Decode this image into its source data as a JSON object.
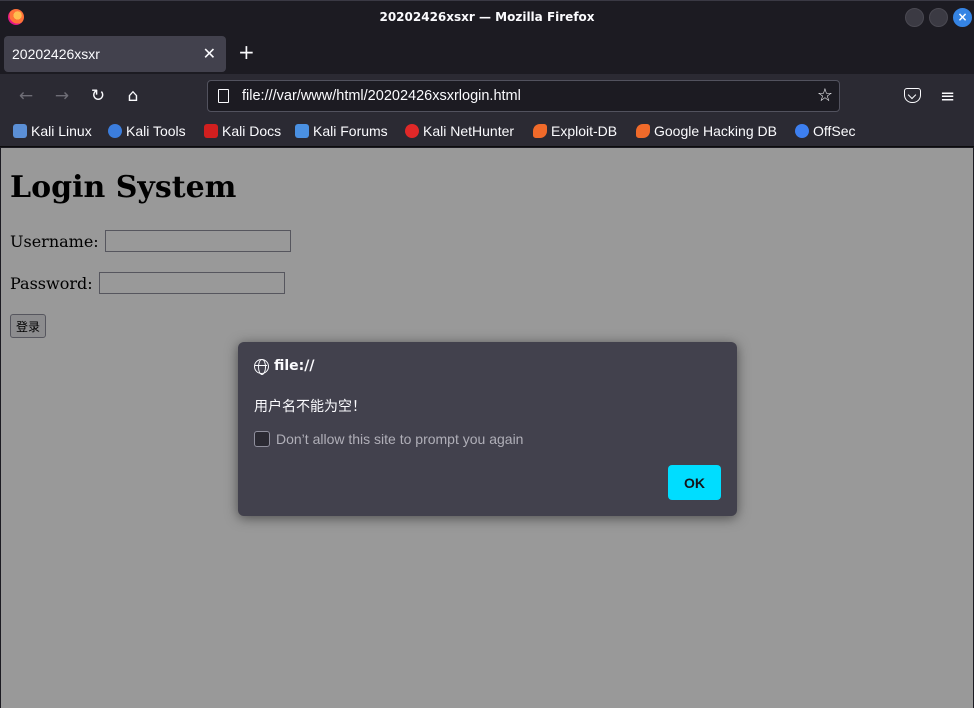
{
  "window": {
    "title": "20202426xsxr — Mozilla Firefox",
    "close_glyph": "×"
  },
  "tab": {
    "title": "20202426xsxr",
    "close_glyph": "✕",
    "newtab_glyph": "+"
  },
  "nav": {
    "back_glyph": "←",
    "forward_glyph": "→",
    "reload_glyph": "↻",
    "home_glyph": "⌂",
    "url": "file:///var/www/html/20202426xsxrlogin.html",
    "star_glyph": "☆",
    "menu_glyph": "≡"
  },
  "bookmarks": [
    {
      "label": "Kali Linux",
      "icon": "kali-dragon-icon",
      "color": "#5b8fd6"
    },
    {
      "label": "Kali Tools",
      "icon": "kali-tools-icon",
      "color": "#3b7ddd"
    },
    {
      "label": "Kali Docs",
      "icon": "kali-docs-icon",
      "color": "#d11f1f"
    },
    {
      "label": "Kali Forums",
      "icon": "kali-forums-icon",
      "color": "#4a90e2"
    },
    {
      "label": "Kali NetHunter",
      "icon": "kali-nethunter-icon",
      "color": "#e02828"
    },
    {
      "label": "Exploit-DB",
      "icon": "exploit-db-icon",
      "color": "#f06a2a"
    },
    {
      "label": "Google Hacking DB",
      "icon": "ghdb-icon",
      "color": "#f06a2a"
    },
    {
      "label": "OffSec",
      "icon": "offsec-icon",
      "color": "#3d7ff0"
    }
  ],
  "page": {
    "heading": "Login System",
    "username_label": "Username:",
    "password_label": "Password:",
    "submit_label": "登录"
  },
  "dialog": {
    "origin": "file://",
    "message": "用户名不能为空！",
    "checkbox_label": "Don’t allow this site to prompt you again",
    "ok_label": "OK",
    "accent_color": "#00ddff"
  }
}
